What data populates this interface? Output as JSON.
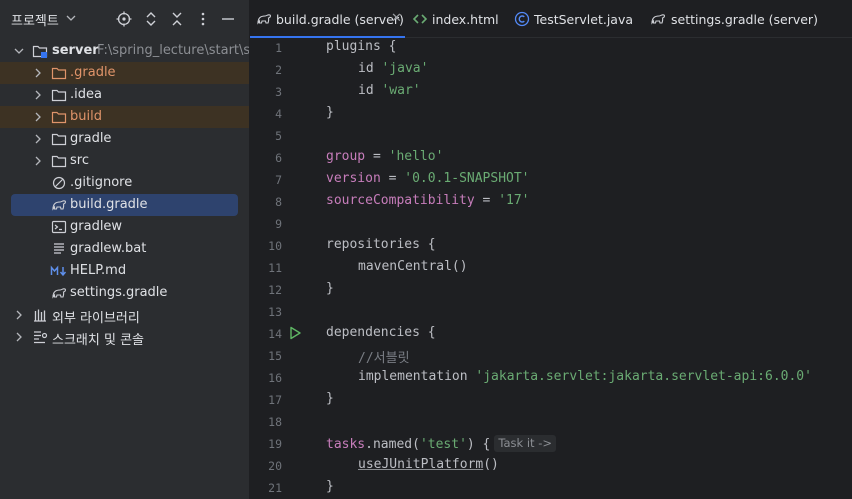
{
  "project_panel": {
    "title": "프로젝트",
    "header_icons": [
      "locate-icon",
      "expand-all-icon",
      "collapse-all-icon",
      "more-options-icon",
      "hide-panel-icon"
    ]
  },
  "tree": {
    "root": {
      "name": "server",
      "path": "F:\\spring_lecture\\start\\s"
    },
    "items": [
      {
        "label": ".gradle",
        "icon": "folder-icon",
        "excluded": true,
        "expandable": true
      },
      {
        "label": ".idea",
        "icon": "folder-icon",
        "excluded": false,
        "expandable": true
      },
      {
        "label": "build",
        "icon": "folder-icon",
        "excluded": true,
        "expandable": true
      },
      {
        "label": "gradle",
        "icon": "folder-icon",
        "excluded": false,
        "expandable": true
      },
      {
        "label": "src",
        "icon": "folder-icon",
        "excluded": false,
        "expandable": true
      },
      {
        "label": ".gitignore",
        "icon": "ignore-file-icon"
      },
      {
        "label": "build.gradle",
        "icon": "gradle-icon",
        "selected": true
      },
      {
        "label": "gradlew",
        "icon": "terminal-file-icon"
      },
      {
        "label": "gradlew.bat",
        "icon": "text-file-icon"
      },
      {
        "label": "HELP.md",
        "icon": "markdown-icon"
      },
      {
        "label": "settings.gradle",
        "icon": "gradle-icon"
      }
    ],
    "external_libraries": "외부 라이브러리",
    "scratches": "스크래치 및 콘솔"
  },
  "tabs": [
    {
      "label": "build.gradle (server)",
      "icon": "gradle-icon",
      "active": true,
      "closable": true
    },
    {
      "label": "index.html",
      "icon": "html-icon"
    },
    {
      "label": "TestServlet.java",
      "icon": "java-class-icon"
    },
    {
      "label": "settings.gradle (server)",
      "icon": "gradle-icon"
    }
  ],
  "editor": {
    "line_numbers": [
      "1",
      "2",
      "3",
      "4",
      "5",
      "6",
      "7",
      "8",
      "9",
      "10",
      "11",
      "12",
      "13",
      "14",
      "15",
      "16",
      "17",
      "18",
      "19",
      "20",
      "21"
    ],
    "tokens": {
      "plugins": "plugins",
      "brace_open": " {",
      "brace_close": "}",
      "id": "id",
      "java": "'java'",
      "war": "'war'",
      "group": "group",
      "eq": " = ",
      "hello": "'hello'",
      "version": "version",
      "snapshot": "'0.0.1-SNAPSHOT'",
      "source_compat": "sourceCompatibility",
      "seventeen": "'17'",
      "repositories": "repositories",
      "maven_central": "mavenCentral()",
      "dependencies": "dependencies",
      "comment_servlet": "//서블릿",
      "implementation": "implementation",
      "servlet_api": "'jakarta.servlet:jakarta.servlet-api:6.0.0'",
      "tasks": "tasks",
      "named_open": ".named(",
      "test": "'test'",
      "named_close": ") {",
      "use_junit": "useJUnitPlatform",
      "parens": "()"
    },
    "inlay_hint": "Task it ->"
  },
  "colors": {
    "accent": "#3574f0",
    "excluded_folder_text": "#e0946a",
    "string": "#6aab73",
    "property": "#c77dbb",
    "run_gutter": "#5fb865"
  }
}
